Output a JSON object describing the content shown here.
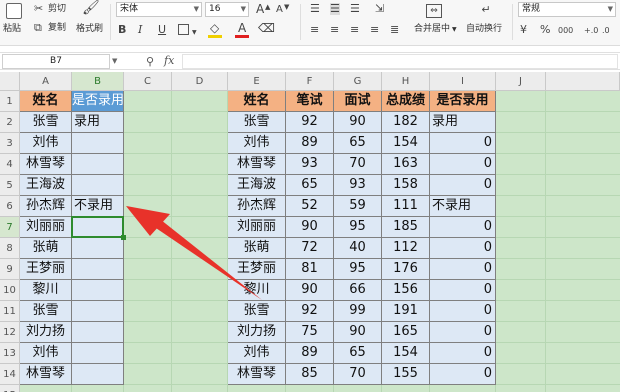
{
  "ribbon": {
    "cut": "剪切",
    "paste": "粘贴",
    "copy": "复制",
    "format_painter": "格式刷",
    "font_name": "宋体",
    "font_size": "16",
    "bold": "B",
    "italic": "I",
    "underline": "U",
    "grow_font": "A",
    "shrink_font": "A",
    "font_color_letter": "A",
    "merge_center": "合并居中",
    "wrap_text": "自动换行",
    "number_format": "常规",
    "percent": "%",
    "thousands": "000"
  },
  "formula_bar": {
    "name_box": "B7",
    "fx": "fx",
    "formula": ""
  },
  "columns": [
    "A",
    "B",
    "C",
    "D",
    "E",
    "F",
    "G",
    "H",
    "I",
    "J"
  ],
  "rows": [
    "1",
    "2",
    "3",
    "4",
    "5",
    "6",
    "7",
    "8",
    "9",
    "10",
    "11",
    "12",
    "13",
    "14",
    "15"
  ],
  "left_table": {
    "headers": [
      "姓名",
      "是否录用"
    ],
    "rows": [
      [
        "张雪",
        "录用"
      ],
      [
        "刘伟",
        ""
      ],
      [
        "林雪琴",
        ""
      ],
      [
        "王海波",
        ""
      ],
      [
        "孙杰辉",
        "不录用"
      ],
      [
        "刘丽丽",
        ""
      ],
      [
        "张萌",
        ""
      ],
      [
        "王梦丽",
        ""
      ],
      [
        "黎川",
        ""
      ],
      [
        "张雪",
        ""
      ],
      [
        "刘力扬",
        ""
      ],
      [
        "刘伟",
        ""
      ],
      [
        "林雪琴",
        ""
      ]
    ]
  },
  "right_table": {
    "headers": [
      "姓名",
      "笔试",
      "面试",
      "总成绩",
      "是否录用"
    ],
    "rows": [
      [
        "张雪",
        "92",
        "90",
        "182",
        "录用"
      ],
      [
        "刘伟",
        "89",
        "65",
        "154",
        "0"
      ],
      [
        "林雪琴",
        "93",
        "70",
        "163",
        "0"
      ],
      [
        "王海波",
        "65",
        "93",
        "158",
        "0"
      ],
      [
        "孙杰辉",
        "52",
        "59",
        "111",
        "不录用"
      ],
      [
        "刘丽丽",
        "90",
        "95",
        "185",
        "0"
      ],
      [
        "张萌",
        "72",
        "40",
        "112",
        "0"
      ],
      [
        "王梦丽",
        "81",
        "95",
        "176",
        "0"
      ],
      [
        "黎川",
        "90",
        "66",
        "156",
        "0"
      ],
      [
        "张雪",
        "92",
        "99",
        "191",
        "0"
      ],
      [
        "刘力扬",
        "75",
        "90",
        "165",
        "0"
      ],
      [
        "刘伟",
        "89",
        "65",
        "154",
        "0"
      ],
      [
        "林雪琴",
        "85",
        "70",
        "155",
        "0"
      ]
    ]
  },
  "colors": {
    "header_orange": "#f4b183",
    "header_blue": "#5b9bd5",
    "body_fill": "#dde8f5",
    "sheet_bg": "#cde6c9",
    "arrow": "#e8322a",
    "active_border": "#2e8b2e"
  }
}
